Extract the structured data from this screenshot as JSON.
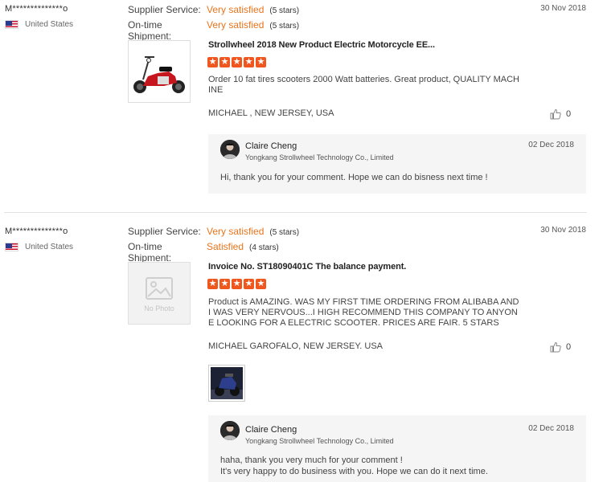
{
  "reviews": [
    {
      "buyer": "M**************o",
      "country": "United States",
      "supplier_service_label": "Supplier Service:",
      "supplier_service_value": "Very satisfied",
      "supplier_service_stars": "(5 stars)",
      "shipment_label": "On-time Shipment:",
      "shipment_value": "Very satisfied",
      "shipment_stars": "(5 stars)",
      "date": "30 Nov 2018",
      "product_title": "Strollwheel 2018 New Product Electric Motorcycle EE...",
      "rating": 5,
      "comment": "Order 10 fat tires scooters 2000 Watt batteries.  Great product,  QUALITY MACHINE",
      "location": "MICHAEL , NEW JERSEY, USA",
      "likes": "0",
      "reply": {
        "name": "Claire Cheng",
        "company": "Yongkang Strollwheel Technology Co., Limited",
        "date": "02 Dec 2018",
        "text_line1": "Hi, thank you for your comment. Hope we can do bisness next time !",
        "text_line2": ""
      }
    },
    {
      "buyer": "M**************o",
      "country": "United States",
      "supplier_service_label": "Supplier Service:",
      "supplier_service_value": "Very satisfied",
      "supplier_service_stars": "(5 stars)",
      "shipment_label": "On-time Shipment:",
      "shipment_value": "Satisfied",
      "shipment_stars": "(4 stars)",
      "date": "30 Nov 2018",
      "product_title": "Invoice No. ST18090401C The balance payment.",
      "rating": 5,
      "thumb_placeholder": "No Photo",
      "comment": "Product is AMAZING.  WAS MY FIRST TIME ORDERING FROM ALIBABA AND I WAS VERY NERVOUS...I HIGH RECOMMEND THIS COMPANY TO ANYONE LOOKING FOR A ELECTRIC SCOOTER.  PRICES ARE FAIR.  5 STARS",
      "location": "MICHAEL GAROFALO,   NEW JERSEY. USA",
      "likes": "0",
      "reply": {
        "name": "Claire Cheng",
        "company": "Yongkang Strollwheel Technology Co., Limited",
        "date": "02 Dec 2018",
        "text_line1": "haha, thank you very much for your comment !",
        "text_line2": "It's very happy  to do business with you. Hope we can do it next time."
      }
    }
  ],
  "icons": {
    "like": "thumbs-up-icon",
    "flag": "us-flag-icon",
    "star": "star-icon"
  },
  "colors": {
    "accent_orange": "#e8741b",
    "star_orange": "#f0571f",
    "reply_bg": "#f5f5f5"
  }
}
